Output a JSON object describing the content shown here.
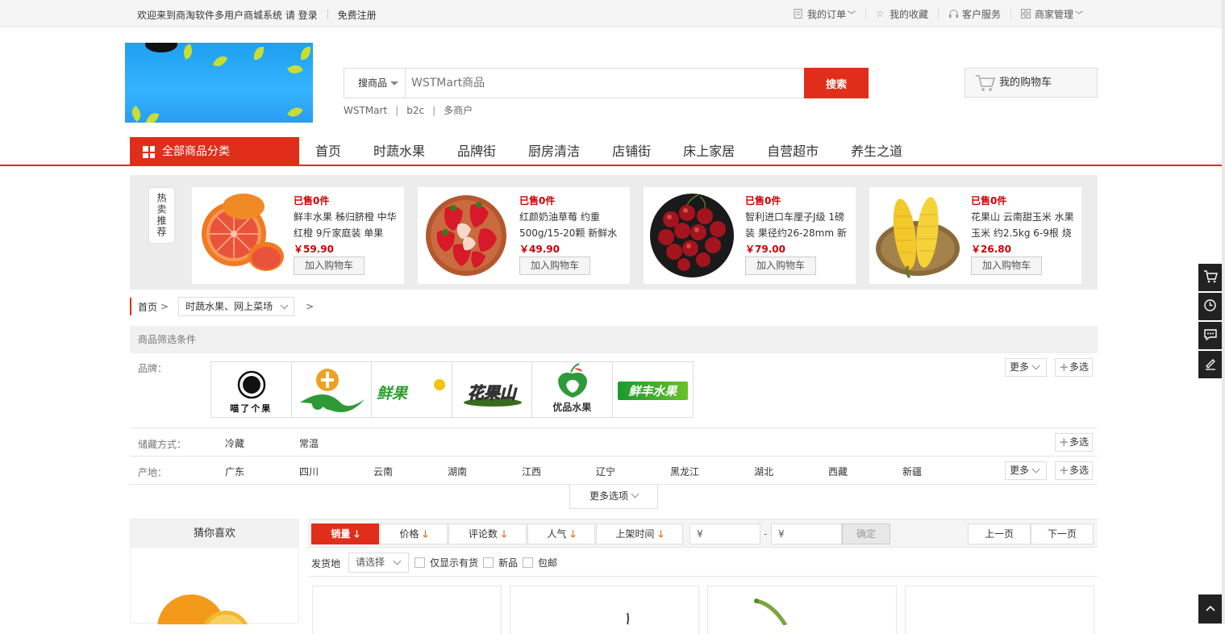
{
  "topbar": {
    "welcome": "欢迎来到商淘软件多用户商城系统 请 登录",
    "register": "免费注册",
    "my_orders": "我的订单",
    "my_favorites": "我的收藏",
    "customer_service": "客户服务",
    "merchant_admin": "商家管理"
  },
  "search": {
    "type": "搜商品",
    "placeholder": "WSTMart商品",
    "button": "搜索",
    "hotwords": [
      "WSTMart",
      "b2c",
      "多商户"
    ]
  },
  "cart": {
    "label": "我的购物车"
  },
  "nav": {
    "all_categories": "全部商品分类",
    "items": [
      "首页",
      "时蔬水果",
      "品牌街",
      "厨房清洁",
      "店铺街",
      "床上家居",
      "自营超市",
      "养生之道"
    ]
  },
  "hot": {
    "tag": "热卖推荐",
    "products": [
      {
        "sold": "已售0件",
        "name": "鲜丰水果 秭归脐橙 中华红橙 9斤家庭装 单果",
        "price": "￥59.90",
        "add": "加入购物车",
        "image": "orange"
      },
      {
        "sold": "已售0件",
        "name": "红颜奶油草莓 约重500g/15-20颗 新鲜水",
        "price": "￥49.90",
        "add": "加入购物车",
        "image": "strawberry"
      },
      {
        "sold": "已售0件",
        "name": "智利进口车厘子J级 1磅装 果径约26-28mm 新",
        "price": "￥79.00",
        "add": "加入购物车",
        "image": "cherry"
      },
      {
        "sold": "已售0件",
        "name": "花果山 云南甜玉米 水果玉米 约2.5kg 6-9根 烧",
        "price": "￥26.80",
        "add": "加入购物车",
        "image": "corn"
      }
    ]
  },
  "breadcrumb": {
    "home": "首页",
    "gt": ">",
    "category": "时蔬水果、网上菜场"
  },
  "filter": {
    "title": "商品筛选条件",
    "brand_label": "品牌：",
    "brands": [
      "喵了个果",
      "",
      "鲜果",
      "花果山",
      "优品水果",
      "鲜丰水果"
    ],
    "storage_label": "储藏方式：",
    "storage": [
      "冷藏",
      "常温"
    ],
    "origin_label": "产地：",
    "origins": [
      "广东",
      "四川",
      "云南",
      "湖南",
      "江西",
      "辽宁",
      "黑龙江",
      "湖北",
      "西藏",
      "新疆"
    ],
    "more": "更多",
    "multi": "多选",
    "more_options": "更多选项"
  },
  "guess": {
    "title": "猜你喜欢"
  },
  "sort": {
    "items": [
      "销量",
      "价格",
      "评论数",
      "人气",
      "上架时间"
    ],
    "arrow": "🡓",
    "currency": "¥",
    "dash": "-",
    "confirm": "确定",
    "prev": "上一页",
    "next": "下一页"
  },
  "ship": {
    "label": "发货地",
    "select": "请选择",
    "in_stock": "仅显示有货",
    "new": "新品",
    "free_ship": "包邮"
  },
  "colors": {
    "accent": "#e02e1b",
    "price": "#cc0000"
  }
}
